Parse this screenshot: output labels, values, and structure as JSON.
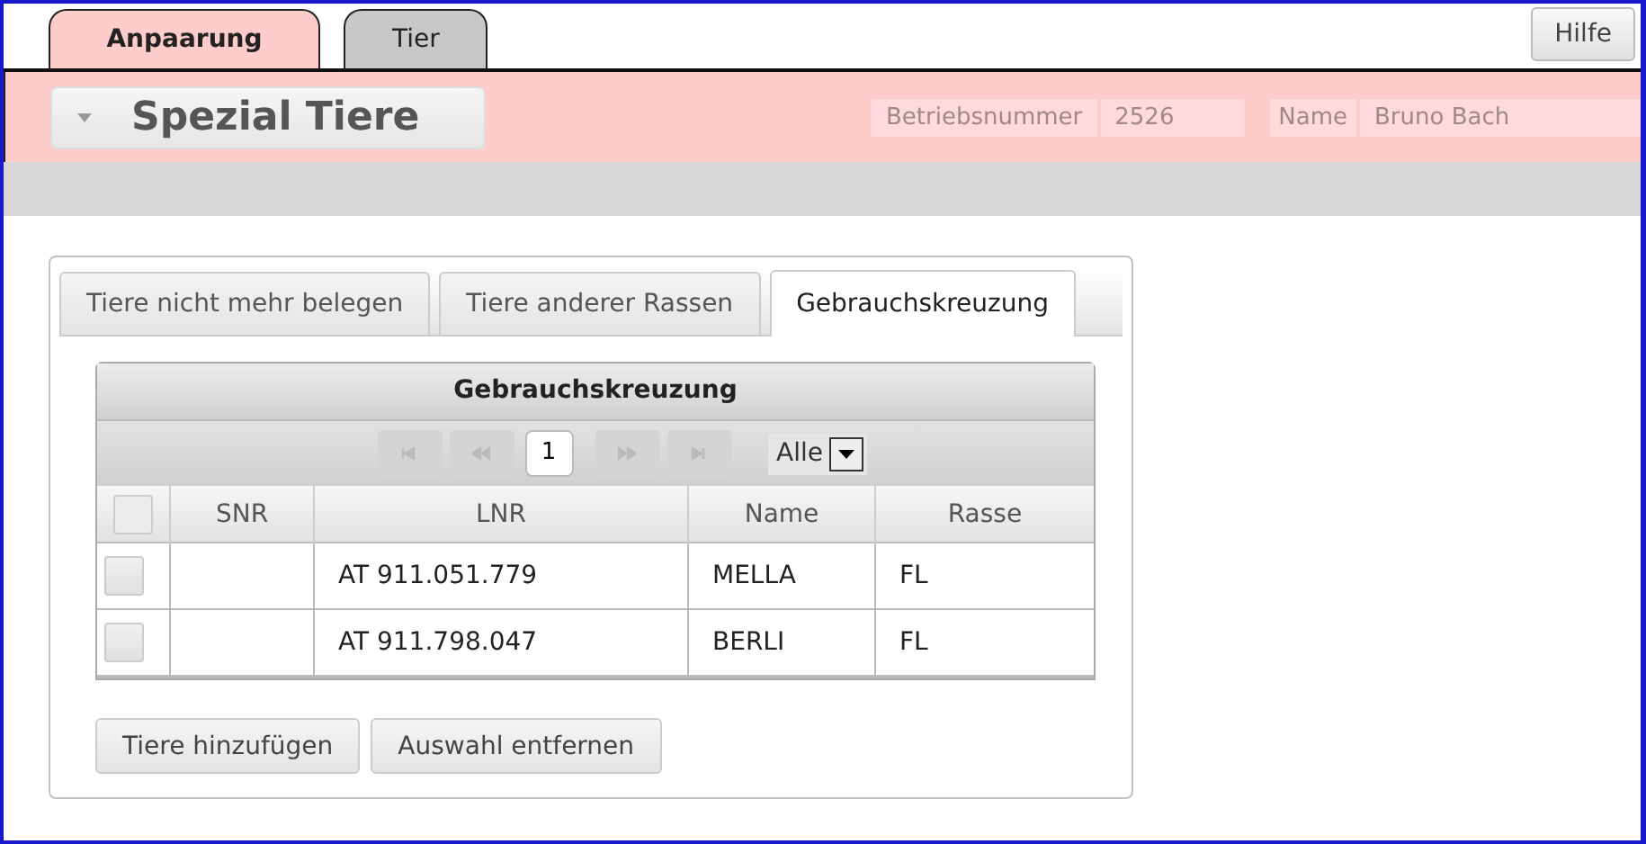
{
  "top_tabs": [
    {
      "label": "Anpaarung",
      "selected": true
    },
    {
      "label": "Tier",
      "selected": false
    }
  ],
  "help_button": "Hilfe",
  "header": {
    "title": "Spezial Tiere",
    "fields": [
      {
        "label": "Betriebsnummer",
        "value": "2526"
      },
      {
        "label": "Name",
        "value": "Bruno Bach"
      }
    ]
  },
  "sub_tabs": [
    {
      "label": "Tiere nicht mehr belegen",
      "selected": false
    },
    {
      "label": "Tiere anderer Rassen",
      "selected": false
    },
    {
      "label": "Gebrauchskreuzung",
      "selected": true
    }
  ],
  "grid": {
    "title": "Gebrauchskreuzung",
    "pager": {
      "nav": [
        {
          "kind": "first",
          "disabled": true
        },
        {
          "kind": "prev",
          "disabled": true
        },
        {
          "kind": "page",
          "value": "1"
        },
        {
          "kind": "next",
          "disabled": true
        },
        {
          "kind": "last",
          "disabled": true
        }
      ],
      "page_size": "Alle"
    },
    "select_all": {
      "checked": false
    },
    "columns": [
      "SNR",
      "LNR",
      "Name",
      "Rasse"
    ],
    "rows": [
      {
        "checked": false,
        "cells": [
          "",
          "AT 911.051.779",
          "MELLA",
          "FL"
        ]
      },
      {
        "checked": false,
        "cells": [
          "",
          "AT 911.798.047",
          "BERLI",
          "FL"
        ]
      }
    ]
  },
  "buttons": [
    "Tiere hinzufügen",
    "Auswahl entfernen"
  ]
}
